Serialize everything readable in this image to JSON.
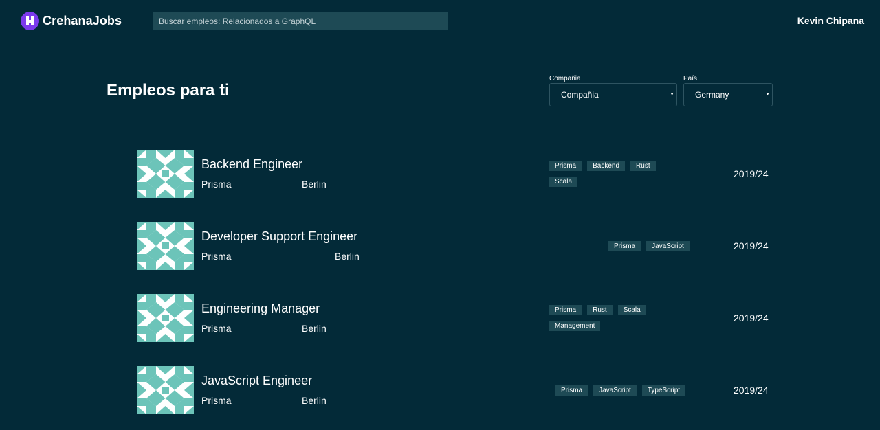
{
  "brand": {
    "name": "CrehanaJobs",
    "accent": "#7C3AED"
  },
  "search": {
    "placeholder": "Buscar empleos: Relacionados a GraphQL",
    "value": ""
  },
  "user": {
    "name": "Kevin Chipana"
  },
  "main": {
    "title": "Empleos para ti"
  },
  "filters": {
    "company": {
      "label": "Compañia",
      "selected": "Compañia"
    },
    "country": {
      "label": "País",
      "selected": "Germany"
    }
  },
  "jobs": [
    {
      "title": "Backend Engineer",
      "company": "Prisma",
      "city": "Berlin",
      "tags": [
        "Prisma",
        "Backend",
        "Rust",
        "Scala"
      ],
      "date": "2019/24"
    },
    {
      "title": "Developer Support Engineer",
      "company": "Prisma",
      "city": "Berlin",
      "tags": [
        "Prisma",
        "JavaScript"
      ],
      "date": "2019/24"
    },
    {
      "title": "Engineering Manager",
      "company": "Prisma",
      "city": "Berlin",
      "tags": [
        "Prisma",
        "Rust",
        "Scala",
        "Management"
      ],
      "date": "2019/24"
    },
    {
      "title": "JavaScript Engineer",
      "company": "Prisma",
      "city": "Berlin",
      "tags": [
        "Prisma",
        "JavaScript",
        "TypeScript"
      ],
      "date": "2019/24"
    }
  ],
  "colors": {
    "background": "#032A38",
    "tag": "#1E4A55",
    "thumbnail": "#6CC4B9"
  }
}
